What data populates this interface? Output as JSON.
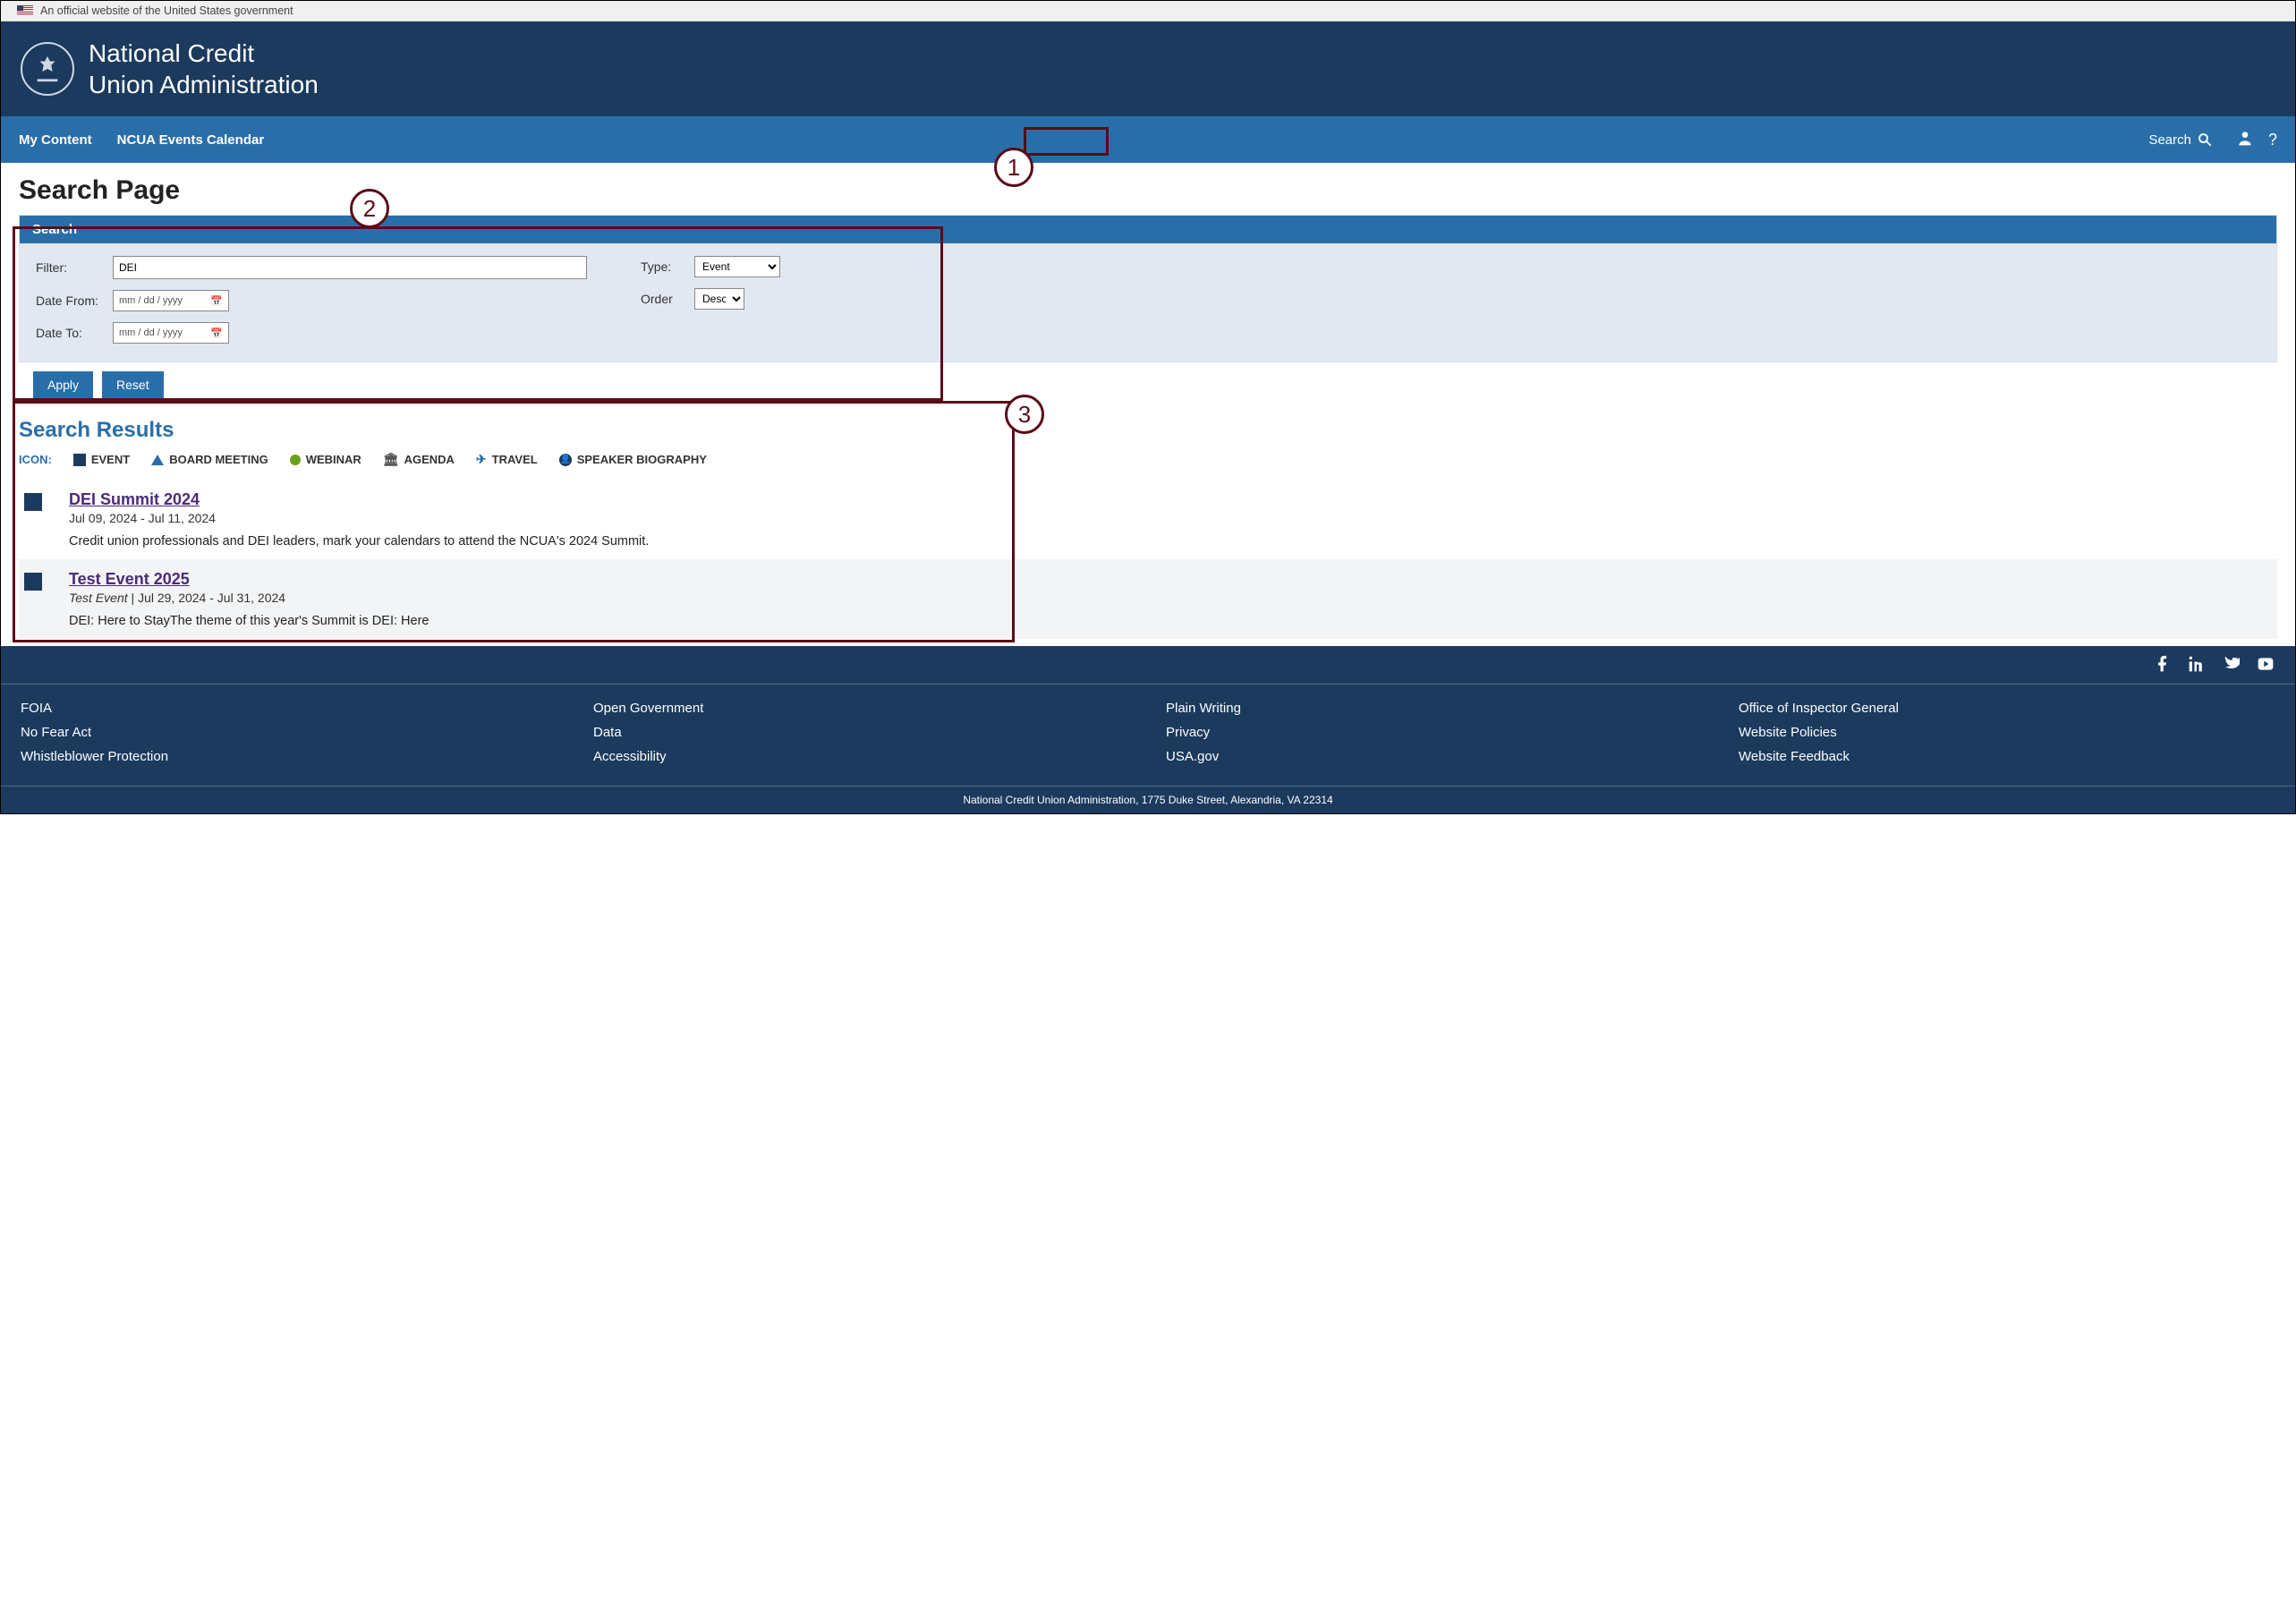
{
  "gov_banner": "An official website of the United States government",
  "site_title_l1": "National Credit",
  "site_title_l2": "Union Administration",
  "nav": {
    "items": [
      "My Content",
      "NCUA Events Calendar"
    ],
    "search_label": "Search"
  },
  "page_title": "Search Page",
  "search_panel": {
    "header": "Search",
    "filter_label": "Filter:",
    "filter_value": "DEI",
    "date_from_label": "Date From:",
    "date_to_label": "Date To:",
    "date_placeholder": "mm / dd / yyyy",
    "type_label": "Type:",
    "type_value": "Event",
    "order_label": "Order",
    "order_value": "Desc",
    "apply_label": "Apply",
    "reset_label": "Reset"
  },
  "results": {
    "header": "Search Results",
    "legend_label": "ICON:",
    "legend": [
      "EVENT",
      "BOARD MEETING",
      "WEBINAR",
      "AGENDA",
      "TRAVEL",
      "SPEAKER BIOGRAPHY"
    ],
    "items": [
      {
        "title": "DEI Summit 2024",
        "subtitle": "",
        "dates": "Jul 09, 2024 - Jul 11, 2024",
        "desc": "Credit union professionals and DEI leaders, mark your calendars to attend the NCUA's 2024 Summit."
      },
      {
        "title": "Test Event 2025",
        "subtitle": "Test Event",
        "dates": "Jul 29, 2024 - Jul 31, 2024",
        "desc": "DEI: Here to StayThe theme of this year's Summit is DEI: Here"
      }
    ]
  },
  "footer": {
    "cols": [
      [
        "FOIA",
        "No Fear Act",
        "Whistleblower Protection"
      ],
      [
        "Open Government",
        "Data",
        "Accessibility"
      ],
      [
        "Plain Writing",
        "Privacy",
        "USA.gov"
      ],
      [
        "Office of Inspector General",
        "Website Policies",
        "Website Feedback"
      ]
    ],
    "address": "National Credit Union Administration, 1775 Duke Street, Alexandria, VA 22314"
  },
  "annotations": [
    "1",
    "2",
    "3"
  ]
}
